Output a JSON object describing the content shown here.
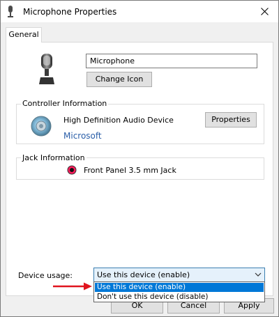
{
  "window": {
    "title": "Microphone Properties"
  },
  "tabs": [
    {
      "label": "General"
    }
  ],
  "general": {
    "device_name": "Microphone",
    "change_icon_label": "Change Icon"
  },
  "controller": {
    "group_label": "Controller Information",
    "device": "High Definition Audio Device",
    "vendor": "Microsoft",
    "properties_label": "Properties"
  },
  "jack": {
    "group_label": "Jack Information",
    "jack_name": "Front Panel 3.5 mm Jack",
    "jack_color": "#ff1c5c"
  },
  "device_usage": {
    "label": "Device usage:",
    "selected": "Use this device (enable)",
    "options": [
      "Use this device (enable)",
      "Don't use this device (disable)"
    ],
    "highlighted_index": 0
  },
  "footer": {
    "ok_label": "OK",
    "cancel_label": "Cancel",
    "apply_label": "Apply"
  },
  "annotation": {
    "arrow_color": "#e0141e"
  },
  "colors": {
    "selection": "#0078d7",
    "link": "#2a5ea8"
  }
}
